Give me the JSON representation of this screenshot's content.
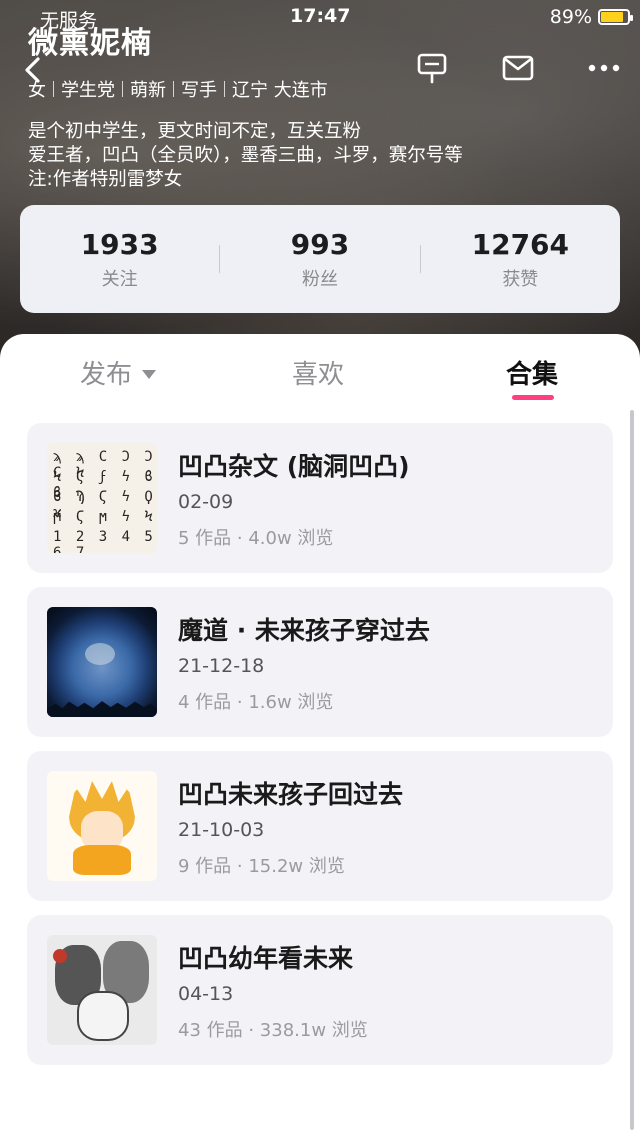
{
  "status_bar": {
    "carrier": "无服务",
    "time": "17:47",
    "battery": "89%",
    "battery_level": 0.89
  },
  "profile": {
    "name": "微熏妮楠",
    "tags": [
      "女",
      "学生党",
      "萌新",
      "写手",
      "辽宁 大连市"
    ],
    "bio": [
      "是个初中学生，更文时间不定，互关互粉",
      "爱王者，凹凸（全员吹），墨香三曲，斗罗，赛尔号等",
      "注:作者特别雷梦女"
    ]
  },
  "stats": [
    {
      "value": "1933",
      "label": "关注"
    },
    {
      "value": "993",
      "label": "粉丝"
    },
    {
      "value": "12764",
      "label": "获赞"
    }
  ],
  "tabs": {
    "publish": "发布",
    "like": "喜欢",
    "collection": "合集"
  },
  "collections": [
    {
      "title": "凹凸杂文 (脑洞凹凸)",
      "date": "02-09",
      "meta": "5 作品 · 4.0w 浏览"
    },
    {
      "title": "魔道 · 未来孩子穿过去",
      "date": "21-12-18",
      "meta": "4 作品 · 1.6w 浏览"
    },
    {
      "title": "凹凸未来孩子回过去",
      "date": "21-10-03",
      "meta": "9 作品 · 15.2w 浏览"
    },
    {
      "title": "凹凸幼年看未来",
      "date": "04-13",
      "meta": "43 作品 · 338.1w 浏览"
    }
  ],
  "thumb1_glyphs": [
    "ϡ ϡ Ϲ Ͻ Ͻ Ϲ Ϟ",
    "Ϟ Ϛ ϝ ϟ ϐ ϐ",
    "ϐ Ϡ Ϛ ϟ Ϙ ϰ",
    "ϻ Ϛ ϻ ϟ Ϟ",
    "1 2 3 4 5 6 7"
  ]
}
